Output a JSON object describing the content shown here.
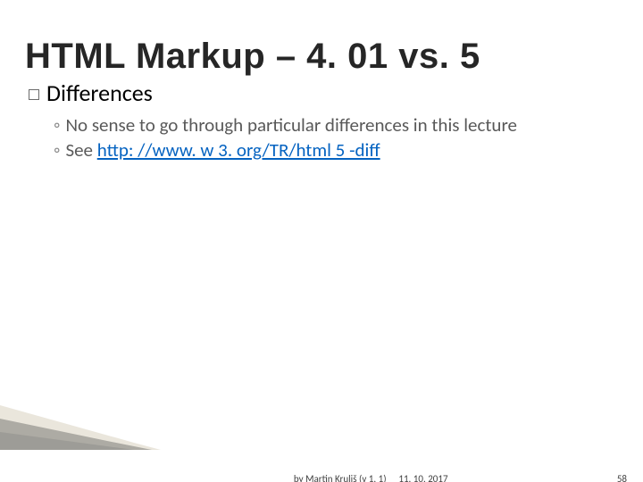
{
  "title": "HTML Markup – 4. 01 vs. 5",
  "section": {
    "heading": "Differences",
    "items": [
      {
        "text": "No sense to go through particular differences in this lecture"
      },
      {
        "prefix": "See ",
        "link_text": "http: //www. w 3. org/TR/html 5 -diff"
      }
    ]
  },
  "footer": {
    "author": "by Martin Kruliš (v 1. 1)",
    "date": "11. 10. 2017",
    "page": "58"
  }
}
